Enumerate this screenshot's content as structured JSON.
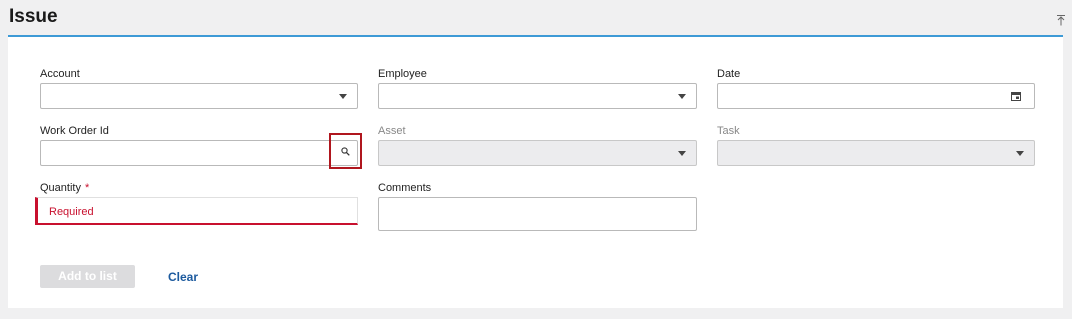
{
  "page": {
    "title": "Issue"
  },
  "fields": {
    "account": {
      "label": "Account",
      "value": ""
    },
    "employee": {
      "label": "Employee",
      "value": ""
    },
    "date": {
      "label": "Date",
      "value": ""
    },
    "work_order_id": {
      "label": "Work Order Id",
      "value": ""
    },
    "asset": {
      "label": "Asset",
      "value": "",
      "disabled": true
    },
    "task": {
      "label": "Task",
      "value": "",
      "disabled": true
    },
    "quantity": {
      "label": "Quantity",
      "required_marker": "*",
      "error": "Required",
      "value": ""
    },
    "comments": {
      "label": "Comments",
      "value": ""
    }
  },
  "actions": {
    "add_label": "Add to list",
    "clear_label": "Clear"
  },
  "icons": {
    "collapse": "collapse-up-icon",
    "dropdown": "chevron-down-icon",
    "calendar": "calendar-icon",
    "lookup": "search-icon"
  },
  "colors": {
    "accent_rule": "#3d9ad6",
    "error": "#c8102e",
    "lookup_highlight": "#b0161e",
    "link": "#1c5a9e"
  }
}
